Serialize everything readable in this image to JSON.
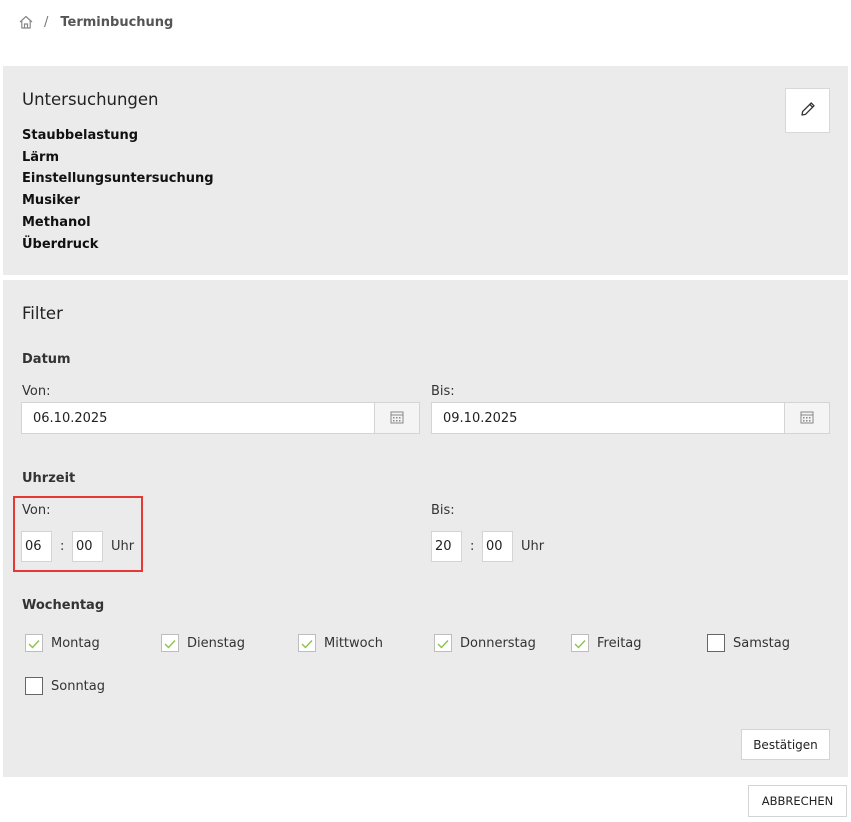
{
  "breadcrumb": {
    "home_icon": "home-icon",
    "separator": "/",
    "current": "Terminbuchung"
  },
  "exams": {
    "title": "Untersuchungen",
    "edit_icon": "pencil-icon",
    "items": [
      "Staubbelastung",
      "Lärm",
      "Einstellungsuntersuchung",
      "Musiker",
      "Methanol",
      "Überdruck"
    ]
  },
  "filter": {
    "title": "Filter",
    "date": {
      "label": "Datum",
      "from_label": "Von:",
      "from_value": "06.10.2025",
      "to_label": "Bis:",
      "to_value": "09.10.2025",
      "calendar_icon": "calendar-icon"
    },
    "time": {
      "label": "Uhrzeit",
      "from_label": "Von:",
      "from_hour": "06",
      "from_minute": "00",
      "to_label": "Bis:",
      "to_hour": "20",
      "to_minute": "00",
      "separator": ":",
      "unit": "Uhr"
    },
    "weekdays": {
      "label": "Wochentag",
      "items": [
        {
          "label": "Montag",
          "checked": true
        },
        {
          "label": "Dienstag",
          "checked": true
        },
        {
          "label": "Mittwoch",
          "checked": true
        },
        {
          "label": "Donnerstag",
          "checked": true
        },
        {
          "label": "Freitag",
          "checked": true
        },
        {
          "label": "Samstag",
          "checked": false
        },
        {
          "label": "Sonntag",
          "checked": false
        }
      ]
    },
    "confirm_label": "Bestätigen"
  },
  "cancel_label": "ABBRECHEN",
  "colors": {
    "panel_bg": "#ebebeb",
    "check_color": "#8bc34a",
    "highlight": "#e53935"
  }
}
